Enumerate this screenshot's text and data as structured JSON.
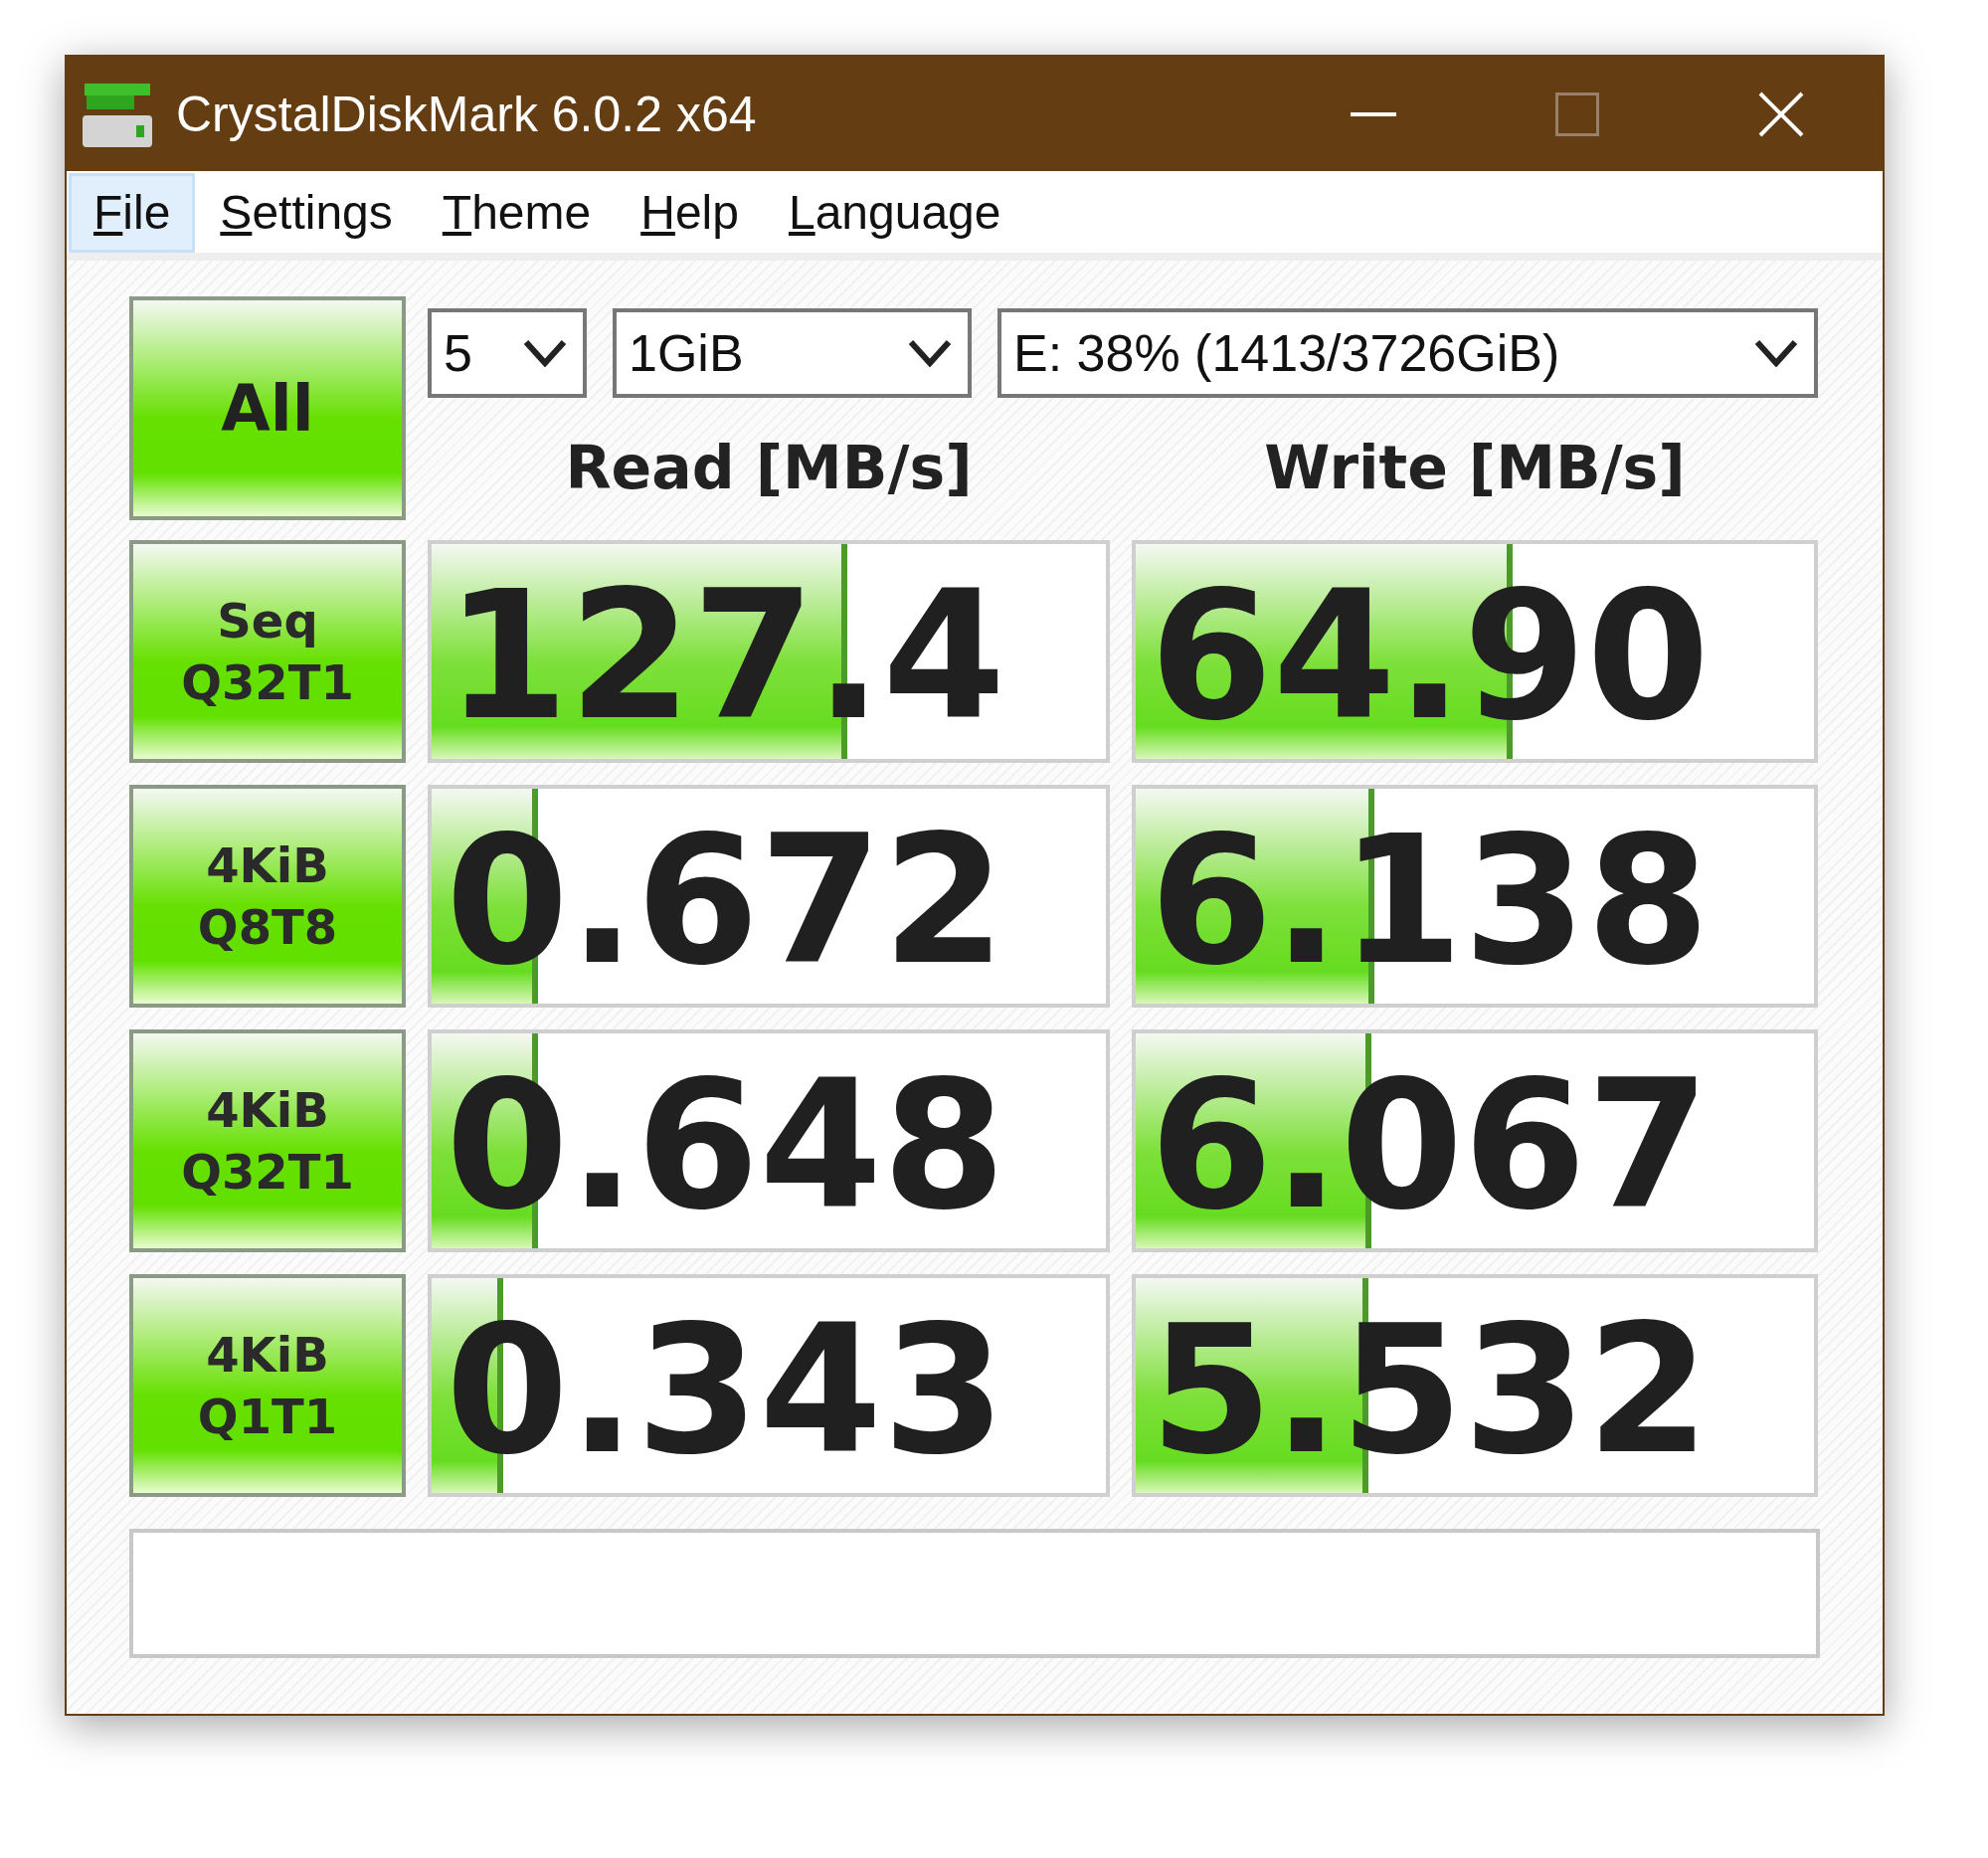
{
  "window": {
    "title": "CrystalDiskMark 6.0.2 x64"
  },
  "menu": [
    {
      "label": "File",
      "selected": true
    },
    {
      "label": "Settings",
      "selected": false
    },
    {
      "label": "Theme",
      "selected": false
    },
    {
      "label": "Help",
      "selected": false
    },
    {
      "label": "Language",
      "selected": false
    }
  ],
  "all_button": "All",
  "selectors": [
    {
      "value": "5"
    },
    {
      "value": "1GiB"
    },
    {
      "value": "E: 38% (1413/3726GiB)"
    }
  ],
  "headers": {
    "read": "Read [MB/s]",
    "write": "Write [MB/s]"
  },
  "rows": [
    {
      "label_line1": "Seq",
      "label_line2": "Q32T1",
      "read": {
        "value": "127.4",
        "level": 0.616
      },
      "write": {
        "value": "64.90",
        "level": 0.556
      }
    },
    {
      "label_line1": "4KiB",
      "label_line2": "Q8T8",
      "read": {
        "value": "0.672",
        "level": 0.158
      },
      "write": {
        "value": "6.138",
        "level": 0.352
      }
    },
    {
      "label_line1": "4KiB",
      "label_line2": "Q32T1",
      "read": {
        "value": "0.648",
        "level": 0.158
      },
      "write": {
        "value": "6.067",
        "level": 0.348
      }
    },
    {
      "label_line1": "4KiB",
      "label_line2": "Q1T1",
      "read": {
        "value": "0.343",
        "level": 0.106
      },
      "write": {
        "value": "5.532",
        "level": 0.343
      }
    }
  ]
}
